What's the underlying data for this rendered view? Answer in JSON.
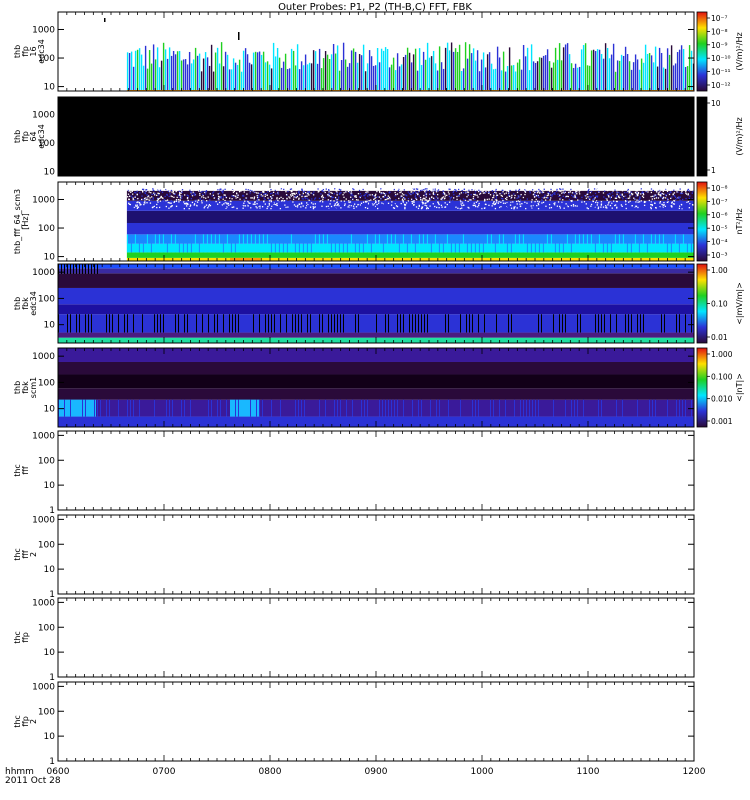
{
  "title": "Outer Probes: P1, P2 (TH-B,C) FFT, FBK",
  "time_axis": {
    "row_label_1": "hhmm",
    "row_label_2": "2011 Oct 28",
    "ticks": [
      "0600",
      "0700",
      "0800",
      "0900",
      "1000",
      "1100",
      "1200"
    ],
    "range_hours": [
      6,
      12
    ]
  },
  "colors": {
    "background": "#000000",
    "low": "#2a0a3a",
    "mid": "#2b32d6",
    "cyan": "#00e5ff",
    "green": "#20d020",
    "yellow": "#ffe000",
    "red": "#e01010",
    "data_bar_orange": "#ff9900"
  },
  "chart_data": [
    {
      "type": "heatmap",
      "panel": "thb_ffp_16_edc34",
      "ylabel_lines": [
        "thb",
        "ffp",
        "16",
        "edc34"
      ],
      "yticks": [
        "10",
        "100",
        "1000"
      ],
      "ylim": [
        7,
        4096
      ],
      "yscale": "log",
      "data_start_hour": 6.65,
      "colorbar": {
        "label": "(V/m)²/Hz",
        "ticks": [
          "10⁻⁷",
          "10⁻⁸",
          "10⁻⁹",
          "10⁻¹⁰",
          "10⁻¹¹",
          "10⁻¹²"
        ]
      }
    },
    {
      "type": "heatmap",
      "panel": "thb_ffp_64_edc34",
      "ylabel_lines": [
        "thb",
        "ffp",
        "64",
        "edc34"
      ],
      "yticks": [
        "10",
        "100",
        "1000"
      ],
      "ylim": [
        7,
        4096
      ],
      "yscale": "log",
      "fill": "black",
      "colorbar": {
        "label": "(V/m)²/Hz",
        "ticks": [
          "10",
          "1"
        ]
      }
    },
    {
      "type": "heatmap",
      "panel": "thb_fff_64_scm3",
      "ylabel_lines": [
        "thb_fff_64_scm3",
        "[Hz]"
      ],
      "yticks": [
        "10",
        "100",
        "1000"
      ],
      "ylim": [
        7,
        4096
      ],
      "yscale": "log",
      "data_start_hour": 6.65,
      "colorbar": {
        "label": "nT²/Hz",
        "ticks": [
          "10⁻⁸",
          "10⁻⁷",
          "10⁻⁶",
          "10⁻⁵",
          "10⁻⁴",
          "10⁻³"
        ]
      }
    },
    {
      "type": "heatmap",
      "panel": "thb_fbk_edc34",
      "ylabel_lines": [
        "thb",
        "fbk",
        "edc34"
      ],
      "yticks": [
        "10",
        "100",
        "1000"
      ],
      "ylim": [
        2,
        2048
      ],
      "yscale": "log",
      "colorbar": {
        "label": "<|mV/m|>",
        "ticks": [
          "1.00",
          "0.10",
          "0.01"
        ]
      }
    },
    {
      "type": "heatmap",
      "panel": "thb_fbk_scm1",
      "ylabel_lines": [
        "thb",
        "fbk",
        "scm1"
      ],
      "yticks": [
        "10",
        "100",
        "1000"
      ],
      "ylim": [
        2,
        2048
      ],
      "yscale": "log",
      "colorbar": {
        "label": "<|nT|>",
        "ticks": [
          "1.000",
          "0.100",
          "0.010",
          "0.001"
        ]
      }
    },
    {
      "type": "heatmap",
      "panel": "thc_fff",
      "ylabel_lines": [
        "thc",
        "fff"
      ],
      "yticks": [
        "1",
        "10",
        "100",
        "1000"
      ],
      "ylim": [
        1,
        1500
      ],
      "yscale": "log",
      "empty": true
    },
    {
      "type": "heatmap",
      "panel": "thc_fff_2",
      "ylabel_lines": [
        "thc",
        "fff",
        "2"
      ],
      "yticks": [
        "1",
        "10",
        "100",
        "1000"
      ],
      "ylim": [
        1,
        1500
      ],
      "yscale": "log",
      "empty": true
    },
    {
      "type": "heatmap",
      "panel": "thc_ffp",
      "ylabel_lines": [
        "thc",
        "ffp"
      ],
      "yticks": [
        "1",
        "10",
        "100",
        "1000"
      ],
      "ylim": [
        1,
        1500
      ],
      "yscale": "log",
      "empty": true
    },
    {
      "type": "heatmap",
      "panel": "thc_ffp_2",
      "ylabel_lines": [
        "thc",
        "ffp",
        "2"
      ],
      "yticks": [
        "1",
        "10",
        "100",
        "1000"
      ],
      "ylim": [
        1,
        1500
      ],
      "yscale": "log",
      "empty": true
    }
  ]
}
